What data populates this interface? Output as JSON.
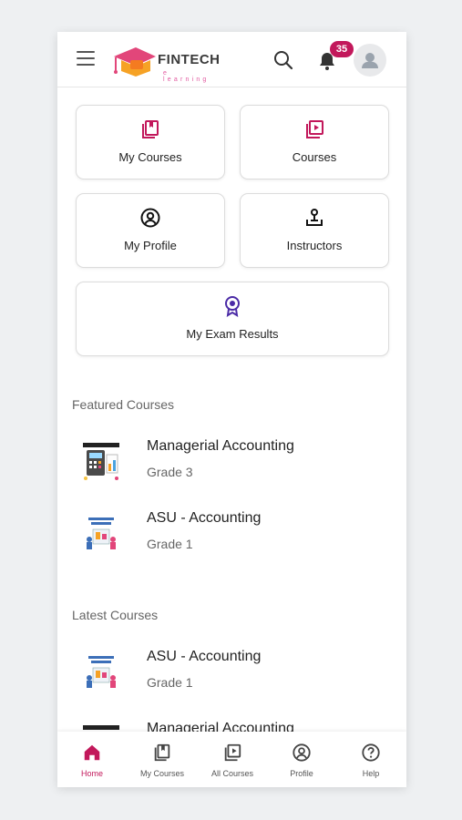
{
  "header": {
    "logo_text": "FINTECH",
    "logo_sub": "e learning",
    "notification_count": "35"
  },
  "tiles": [
    {
      "label": "My Courses",
      "icon": "bookmark-book-icon"
    },
    {
      "label": "Courses",
      "icon": "video-library-icon"
    },
    {
      "label": "My Profile",
      "icon": "user-circle-icon"
    },
    {
      "label": "Instructors",
      "icon": "instructor-icon"
    },
    {
      "label": "My Exam Results",
      "icon": "award-medal-icon"
    }
  ],
  "featured": {
    "title": "Featured Courses",
    "courses": [
      {
        "name": "Managerial Accounting",
        "grade": "Grade 3"
      },
      {
        "name": "ASU - Accounting",
        "grade": "Grade 1"
      }
    ]
  },
  "latest": {
    "title": "Latest Courses",
    "courses": [
      {
        "name": "ASU - Accounting",
        "grade": "Grade 1"
      },
      {
        "name": "Managerial Accounting",
        "grade": ""
      }
    ]
  },
  "bottom_nav": [
    {
      "label": "Home",
      "icon": "home-icon",
      "active": true
    },
    {
      "label": "My Courses",
      "icon": "my-courses-icon"
    },
    {
      "label": "All Courses",
      "icon": "all-courses-icon"
    },
    {
      "label": "Profile",
      "icon": "profile-icon"
    },
    {
      "label": "Help",
      "icon": "help-icon"
    }
  ],
  "colors": {
    "accent": "#c2185b",
    "exam_icon": "#4b2ba6"
  }
}
